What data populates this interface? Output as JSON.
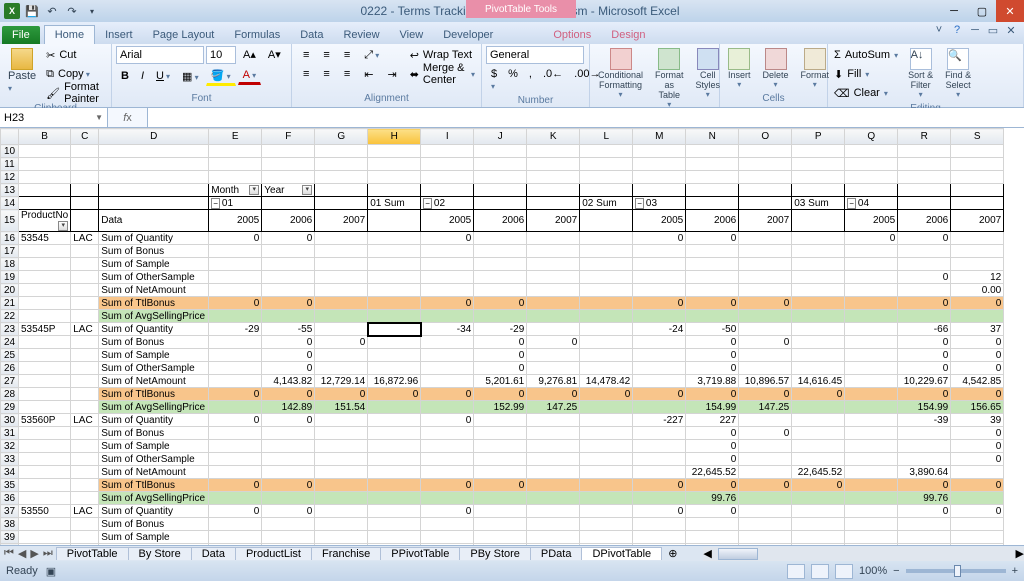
{
  "window": {
    "title": "0222 - Terms Tracking_selection MAT.xlsm - Microsoft Excel",
    "context_tab_group": "PivotTable Tools"
  },
  "tabs": {
    "file": "File",
    "home": "Home",
    "insert": "Insert",
    "page_layout": "Page Layout",
    "formulas": "Formulas",
    "data": "Data",
    "review": "Review",
    "view": "View",
    "developer": "Developer",
    "options": "Options",
    "design": "Design"
  },
  "ribbon": {
    "clipboard": {
      "label": "Clipboard",
      "paste": "Paste",
      "cut": "Cut",
      "copy": "Copy",
      "format_painter": "Format Painter"
    },
    "font": {
      "label": "Font",
      "name": "Arial",
      "size": "10"
    },
    "alignment": {
      "label": "Alignment",
      "wrap": "Wrap Text",
      "merge": "Merge & Center"
    },
    "number": {
      "label": "Number",
      "format": "General"
    },
    "styles": {
      "label": "Styles",
      "cond": "Conditional\nFormatting",
      "table": "Format\nas Table",
      "cell": "Cell\nStyles"
    },
    "cells": {
      "label": "Cells",
      "insert": "Insert",
      "delete": "Delete",
      "format": "Format"
    },
    "editing": {
      "label": "Editing",
      "autosum": "AutoSum",
      "fill": "Fill",
      "clear": "Clear",
      "sort": "Sort &\nFilter",
      "find": "Find &\nSelect"
    }
  },
  "namebox": "H23",
  "columns": [
    "B",
    "C",
    "D",
    "E",
    "F",
    "G",
    "H",
    "I",
    "J",
    "K",
    "L",
    "M",
    "N",
    "O",
    "P",
    "Q",
    "R",
    "S"
  ],
  "rows_start": 10,
  "pivot_fields": {
    "col_field1": "Month",
    "col_field2": "Year",
    "row_field1": "ProductNo",
    "row_field2": "Data"
  },
  "months": {
    "m01": "01",
    "m01sum": "01 Sum",
    "m02": "02",
    "m02sum": "02 Sum",
    "m03": "03",
    "m03sum": "03 Sum",
    "m04": "04"
  },
  "years": [
    "2005",
    "2006",
    "2007"
  ],
  "data_labels": {
    "qty": "Sum of Quantity",
    "bonus": "Sum of Bonus",
    "sample": "Sum of Sample",
    "other": "Sum of OtherSample",
    "net": "Sum of NetAmount",
    "ttl": "Sum of TtlBonus",
    "avg": "Sum of AvgSellingPrice"
  },
  "products": {
    "p1": "53545",
    "p1cat": "LAC",
    "p2": "53545P",
    "p2cat": "LAC",
    "p3": "53560P",
    "p3cat": "LAC",
    "p4": "53550",
    "p4cat": "LAC"
  },
  "chart_data": {
    "type": "table",
    "note": "Pivot crosstab; columns = Month -> Year; values shown where present",
    "rows": [
      {
        "r": 16,
        "prod": "53545",
        "measure": "qty",
        "E": 0,
        "F": 0,
        "I": 0,
        "M": 0,
        "N": 0,
        "Q": 0,
        "R": 0
      },
      {
        "r": 19,
        "prod": "53545",
        "measure": "other",
        "R": 0,
        "S": 12
      },
      {
        "r": 20,
        "prod": "53545",
        "measure": "net",
        "S": "0.00"
      },
      {
        "r": 21,
        "prod": "53545",
        "measure": "ttl",
        "E": 0,
        "F": 0,
        "I": 0,
        "J": 0,
        "M": 0,
        "N": 0,
        "O": 0,
        "R": 0,
        "S": 0
      },
      {
        "r": 23,
        "prod": "53545P",
        "measure": "qty",
        "E": -29,
        "F": -55,
        "I": -34,
        "J": -29,
        "M": -24,
        "N": -50,
        "R": -66,
        "S": 37
      },
      {
        "r": 24,
        "prod": "53545P",
        "measure": "bonus",
        "F": 0,
        "G": 0,
        "J": 0,
        "K": 0,
        "N": 0,
        "O": 0,
        "R": 0,
        "S": 0
      },
      {
        "r": 25,
        "prod": "53545P",
        "measure": "sample",
        "F": 0,
        "J": 0,
        "N": 0,
        "R": 0,
        "S": 0
      },
      {
        "r": 26,
        "prod": "53545P",
        "measure": "other",
        "F": 0,
        "J": 0,
        "N": 0,
        "R": 0,
        "S": 0
      },
      {
        "r": 27,
        "prod": "53545P",
        "measure": "net",
        "F": "4,143.82",
        "G": "12,729.14",
        "H": "16,872.96",
        "J": "5,201.61",
        "K": "9,276.81",
        "L": "14,478.42",
        "N": "3,719.88",
        "O": "10,896.57",
        "P": "14,616.45",
        "R": "10,229.67",
        "S": "4,542.85"
      },
      {
        "r": 28,
        "prod": "53545P",
        "measure": "ttl",
        "E": 0,
        "F": 0,
        "G": 0,
        "H": 0,
        "I": 0,
        "J": 0,
        "K": 0,
        "L": 0,
        "M": 0,
        "N": 0,
        "O": 0,
        "P": 0,
        "R": 0,
        "S": 0
      },
      {
        "r": 29,
        "prod": "53545P",
        "measure": "avg",
        "F": "142.89",
        "G": "151.54",
        "J": "152.99",
        "K": "147.25",
        "N": "154.99",
        "O": "147.25",
        "R": "154.99",
        "S": "156.65"
      },
      {
        "r": 30,
        "prod": "53560P",
        "measure": "qty",
        "E": 0,
        "F": 0,
        "I": 0,
        "M": -227,
        "N": 227,
        "R": -39,
        "S": 39
      },
      {
        "r": 31,
        "prod": "53560P",
        "measure": "bonus",
        "N": 0,
        "O": 0,
        "S": 0
      },
      {
        "r": 32,
        "prod": "53560P",
        "measure": "sample",
        "N": 0,
        "S": 0
      },
      {
        "r": 33,
        "prod": "53560P",
        "measure": "other",
        "N": 0,
        "S": 0
      },
      {
        "r": 34,
        "prod": "53560P",
        "measure": "net",
        "N": "22,645.52",
        "P": "22,645.52",
        "R": "3,890.64"
      },
      {
        "r": 35,
        "prod": "53560P",
        "measure": "ttl",
        "E": 0,
        "F": 0,
        "I": 0,
        "J": 0,
        "M": 0,
        "N": 0,
        "O": 0,
        "P": 0,
        "R": 0,
        "S": 0
      },
      {
        "r": 36,
        "prod": "53560P",
        "measure": "avg",
        "N": "99.76",
        "R": "99.76"
      },
      {
        "r": 37,
        "prod": "53550",
        "measure": "qty",
        "E": 0,
        "F": 0,
        "I": 0,
        "M": 0,
        "N": 0,
        "R": 0,
        "S": 0
      }
    ]
  },
  "sheet_tabs": [
    "PivotTable",
    "By Store",
    "Data",
    "ProductList",
    "Franchise",
    "PPivotTable",
    "PBy Store",
    "PData",
    "DPivotTable"
  ],
  "active_sheet": "DPivotTable",
  "status": {
    "ready": "Ready",
    "zoom": "100%"
  }
}
